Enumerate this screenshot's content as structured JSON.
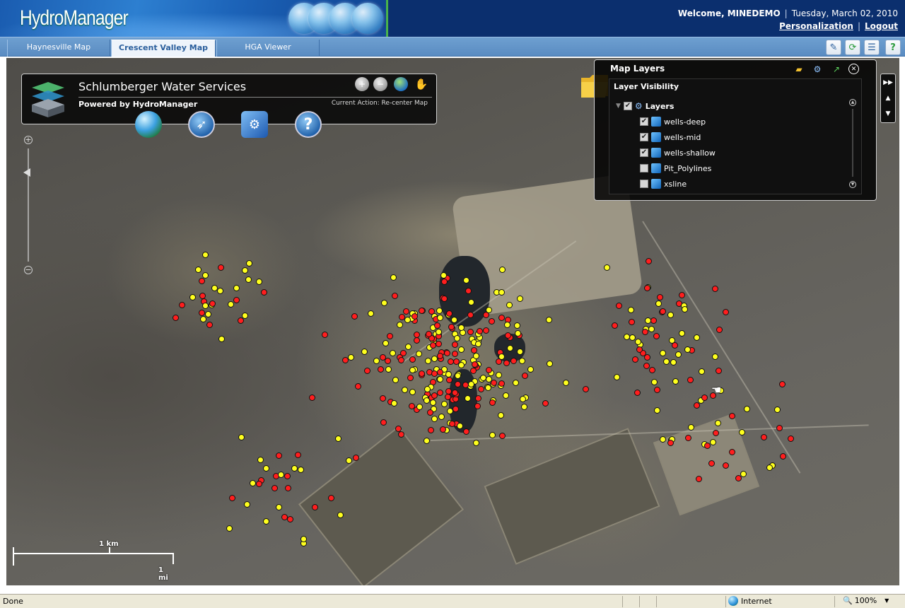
{
  "app": {
    "logo_text": "HydroManager",
    "welcome": "Welcome, MINEDEMO",
    "date": "Tuesday, March 02, 2010",
    "personalization": "Personalization",
    "logout": "Logout"
  },
  "tabs": [
    {
      "label": "Haynesville Map",
      "active": false
    },
    {
      "label": "Crescent Valley Map",
      "active": true
    },
    {
      "label": "HGA Viewer",
      "active": false
    }
  ],
  "toolbar_icons": [
    "edit-icon",
    "refresh-icon",
    "notes-icon",
    "help-icon"
  ],
  "title_panel": {
    "title": "Schlumberger Water Services",
    "subtitle": "Powered by HydroManager",
    "current_action": "Current Action: Re-center Map",
    "small_tools": [
      "zoom-in-icon",
      "zoom-out-icon",
      "full-extent-icon",
      "pan-hand-icon"
    ],
    "big_tools": [
      "globe-icon",
      "compass-icon",
      "settings-icon",
      "help-icon"
    ]
  },
  "layers_panel": {
    "title": "Map Layers",
    "visibility_label": "Layer Visibility",
    "root_label": "Layers",
    "layers": [
      {
        "name": "wells-deep",
        "checked": true
      },
      {
        "name": "wells-mid",
        "checked": true
      },
      {
        "name": "wells-shallow",
        "checked": true
      },
      {
        "name": "Pit_Polylines",
        "checked": false
      },
      {
        "name": "xsline",
        "checked": false
      }
    ]
  },
  "scale": {
    "km": "1 km",
    "mi": "1 mi"
  },
  "status": {
    "left": "Done",
    "zone": "Internet",
    "zoom": "100%"
  },
  "colors": {
    "well_red": "#ff1e1e",
    "well_yellow": "#ffff1e",
    "header_bg": "#0b2f6e",
    "tab_bar": "#5a8cc2"
  }
}
